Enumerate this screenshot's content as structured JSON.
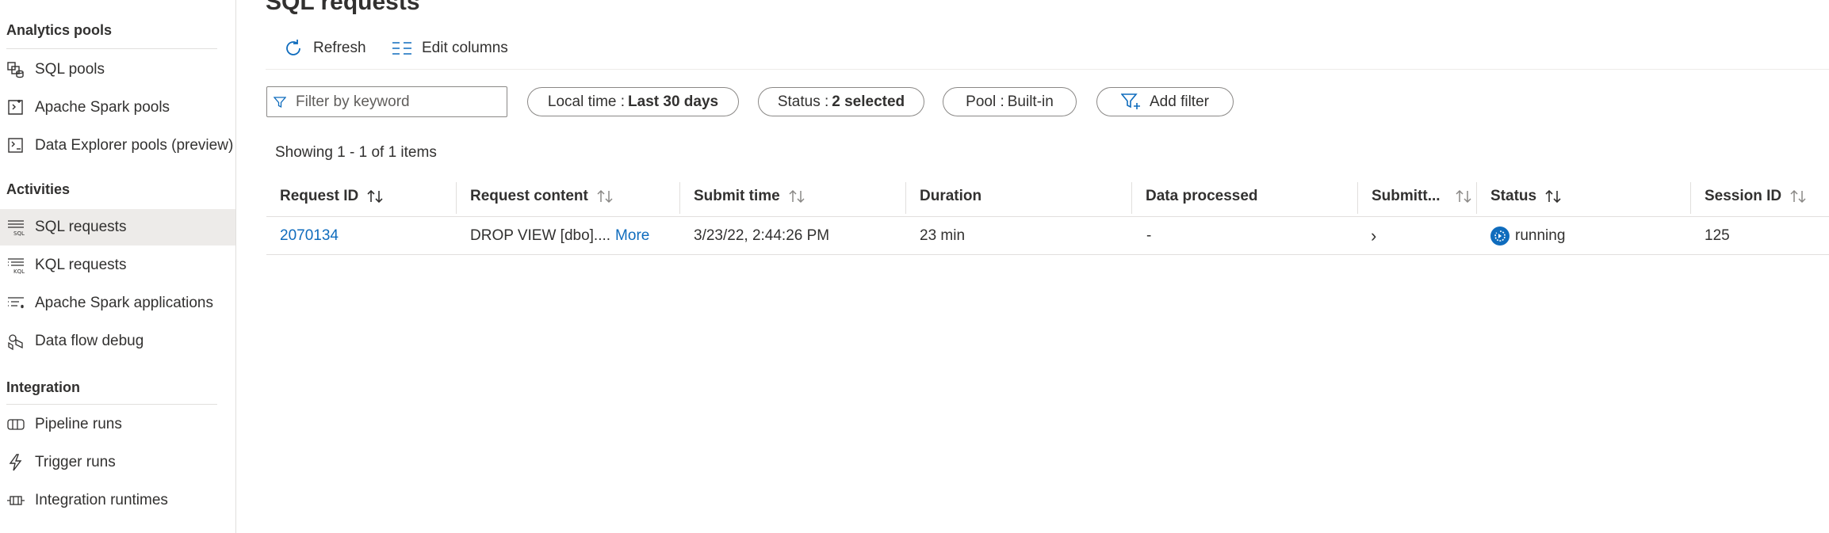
{
  "page": {
    "title": "SQL requests"
  },
  "sidebar": {
    "sections": [
      {
        "header": "Analytics pools",
        "items": [
          {
            "label": "SQL pools",
            "icon": "sql-pools-icon"
          },
          {
            "label": "Apache Spark pools",
            "icon": "spark-pools-icon"
          },
          {
            "label": "Data Explorer pools (preview)",
            "icon": "data-explorer-icon"
          }
        ]
      },
      {
        "header": "Activities",
        "items": [
          {
            "label": "SQL requests",
            "icon": "sql-requests-icon",
            "active": true
          },
          {
            "label": "KQL requests",
            "icon": "kql-requests-icon"
          },
          {
            "label": "Apache Spark applications",
            "icon": "spark-applications-icon"
          },
          {
            "label": "Data flow debug",
            "icon": "data-flow-debug-icon"
          }
        ]
      },
      {
        "header": "Integration",
        "items": [
          {
            "label": "Pipeline runs",
            "icon": "pipeline-runs-icon"
          },
          {
            "label": "Trigger runs",
            "icon": "trigger-runs-icon"
          },
          {
            "label": "Integration runtimes",
            "icon": "integration-runtimes-icon"
          }
        ]
      }
    ]
  },
  "toolbar": {
    "refresh_label": "Refresh",
    "edit_columns_label": "Edit columns"
  },
  "filters": {
    "search_placeholder": "Filter by keyword",
    "local_time": {
      "key": "Local time :",
      "value": "Last 30 days"
    },
    "status": {
      "key": "Status :",
      "value": "2 selected"
    },
    "pool": {
      "key": "Pool :",
      "value": "Built-in"
    },
    "add_filter_label": "Add filter"
  },
  "summary": "Showing 1 - 1 of 1 items",
  "table": {
    "columns": [
      {
        "label": "Request ID",
        "sortable": true
      },
      {
        "label": "Request content",
        "sortable": true
      },
      {
        "label": "Submit time",
        "sortable": true
      },
      {
        "label": "Duration",
        "sortable": false
      },
      {
        "label": "Data processed",
        "sortable": false
      },
      {
        "label": "Submitt...",
        "sortable": true
      },
      {
        "label": "Status",
        "sortable": true
      },
      {
        "label": "Session ID",
        "sortable": true
      }
    ],
    "rows": [
      {
        "request_id": "2070134",
        "request_content": "DROP VIEW [dbo]....",
        "more_label": "More",
        "submit_time": "3/23/22, 2:44:26 PM",
        "duration": "23 min",
        "data_processed": "-",
        "submitter": "›",
        "status": "running",
        "session_id": "125"
      }
    ]
  },
  "colors": {
    "accent": "#0f6cbd",
    "active_nav": "#edebe9",
    "border": "#8a8886"
  }
}
